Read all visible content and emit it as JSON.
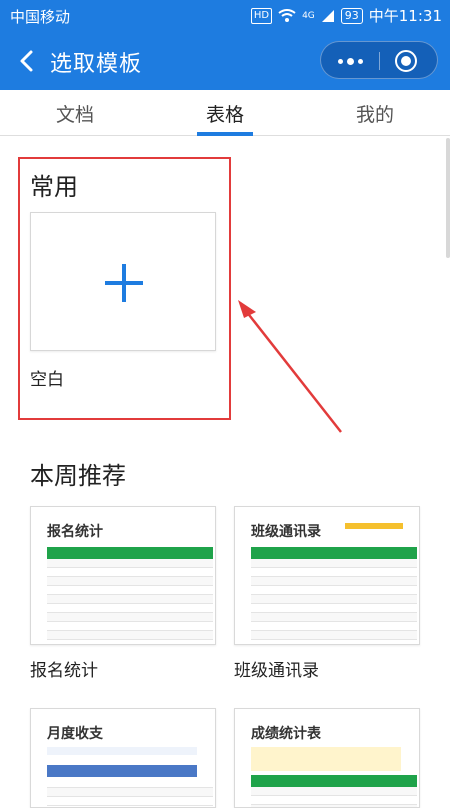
{
  "status_bar": {
    "carrier": "中国移动",
    "hd": "HD",
    "network": "4G",
    "battery": "93",
    "time": "中午11:31"
  },
  "header": {
    "title": "选取模板"
  },
  "tabs": [
    {
      "label": "文档",
      "active": false
    },
    {
      "label": "表格",
      "active": true
    },
    {
      "label": "我的",
      "active": false
    }
  ],
  "common": {
    "title": "常用",
    "blank_label": "空白"
  },
  "weekly": {
    "title": "本周推荐",
    "templates": [
      {
        "label": "报名统计",
        "thumb_title": "报名统计"
      },
      {
        "label": "班级通讯录",
        "thumb_title": "班级通讯录"
      },
      {
        "label": "",
        "thumb_title": "月度收支"
      },
      {
        "label": "",
        "thumb_title": "成绩统计表"
      }
    ]
  },
  "colors": {
    "accent": "#1e7ce0",
    "highlight": "#e23b3b",
    "sheet_green": "#1fa34a"
  }
}
